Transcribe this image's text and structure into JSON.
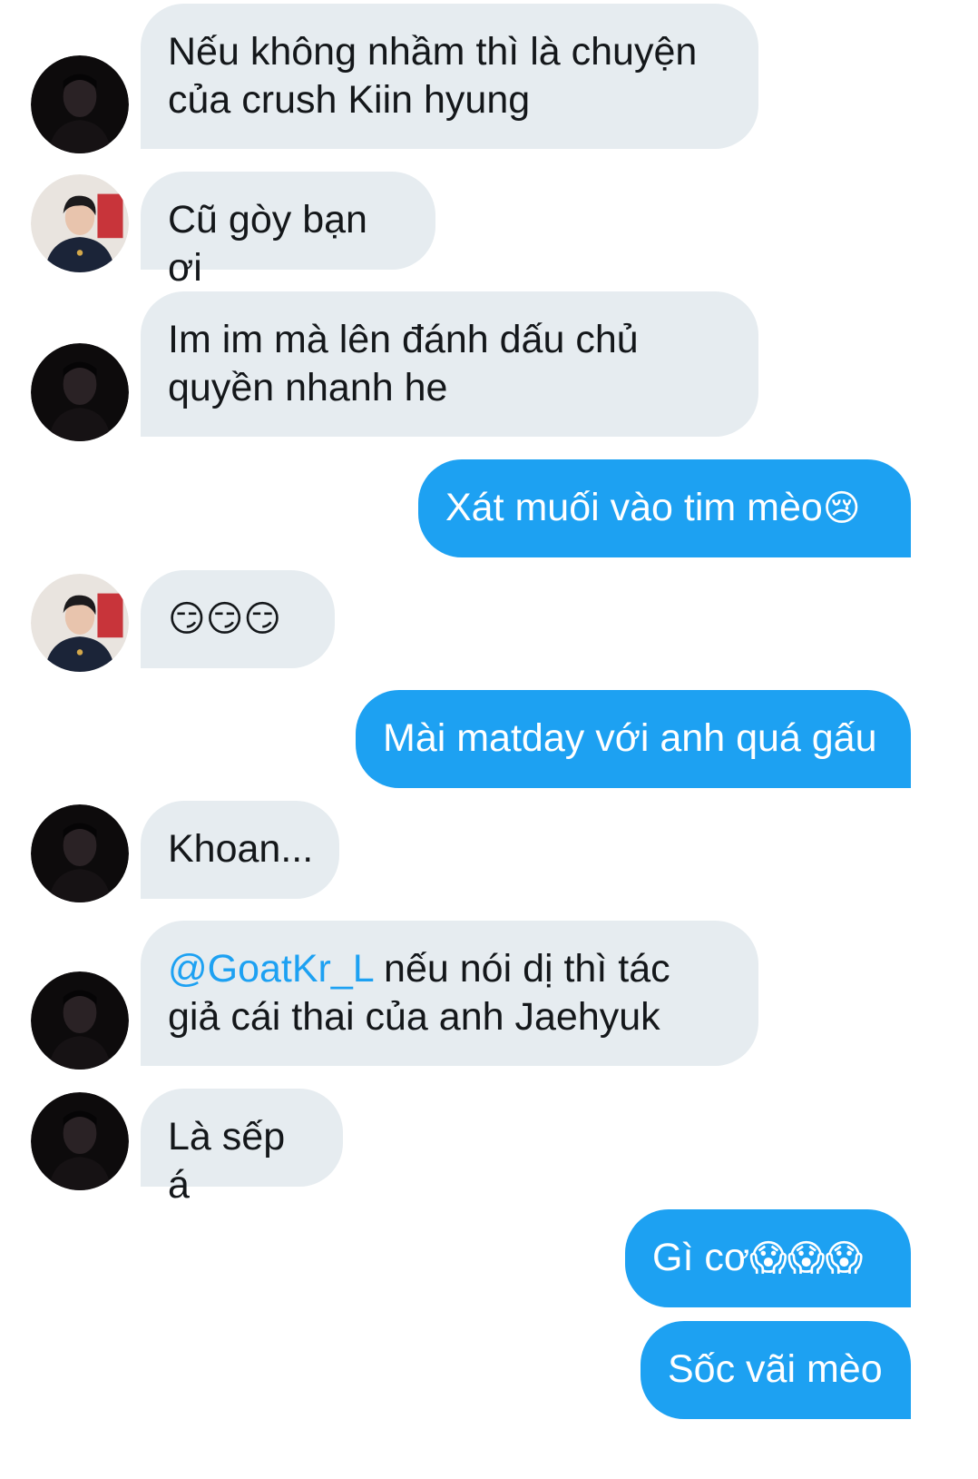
{
  "messages": [
    {
      "id": "m1",
      "dir": "in",
      "avatar": "dark",
      "text": "Nếu không nhầm thì là chuyện\ncủa crush Kiin hyung"
    },
    {
      "id": "m2",
      "dir": "in",
      "avatar": "light",
      "text": "Cũ gòy bạn ơi"
    },
    {
      "id": "m3",
      "dir": "in",
      "avatar": "dark",
      "text": "Im im mà lên đánh dấu chủ\nquyền nhanh he"
    },
    {
      "id": "m4",
      "dir": "out",
      "text": "Xát muối vào tim mèo",
      "emoji": "😢"
    },
    {
      "id": "m5",
      "dir": "in",
      "avatar": "light",
      "text": "",
      "emoji": "😏😏😏"
    },
    {
      "id": "m6",
      "dir": "out",
      "text": "Mài matday với anh quá gấu"
    },
    {
      "id": "m7",
      "dir": "in",
      "avatar": "dark",
      "text": "Khoan..."
    },
    {
      "id": "m8",
      "dir": "in",
      "avatar": "dark",
      "mention": "@GoatKr_L",
      "text": " nếu nói dị thì tác\ngiả cái thai của anh Jaehyuk"
    },
    {
      "id": "m9",
      "dir": "in",
      "avatar": "dark",
      "text": "Là sếp á"
    },
    {
      "id": "m10",
      "dir": "out",
      "text": "Gì cơ",
      "emoji": "😱😱😱"
    },
    {
      "id": "m11",
      "dir": "out",
      "text": "Sốc vãi mèo"
    }
  ],
  "colors": {
    "incoming_bubble": "#e6ecf0",
    "outgoing_bubble": "#1da1f2",
    "mention": "#1da1f2",
    "incoming_text": "#14171a",
    "outgoing_text": "#ffffff"
  }
}
